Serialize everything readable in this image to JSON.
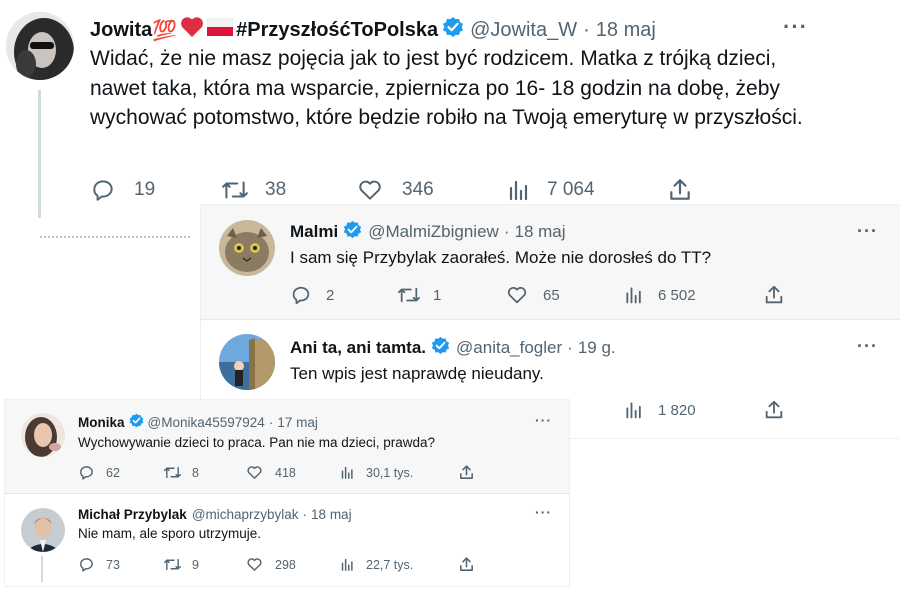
{
  "colors": {
    "verified": "#1d9bf0",
    "muted": "#536471",
    "text": "#0f1419",
    "heart": "#f91880",
    "flag_red": "#dc143c"
  },
  "tweets": [
    {
      "name": "Jowita",
      "emoji": "💯",
      "hashtag": "#PrzyszłośćToPolska",
      "verified": true,
      "handle": "@Jowita_W",
      "sep": "·",
      "date": "18 maj",
      "text": "Widać, że nie masz pojęcia jak to jest być rodzicem. Matka z trójką dzieci, nawet taka, która ma wsparcie, zpiernicza po 16- 18 godzin na dobę, żeby wychować potomstwo, które będzie robiło na Twoją emeryturę w przyszłości.",
      "replies": "19",
      "retweets": "38",
      "likes": "346",
      "views": "7 064",
      "icons": [
        "reply-icon",
        "retweet-icon",
        "like-icon",
        "views-icon",
        "share-icon"
      ]
    },
    {
      "name": "Malmi",
      "verified": true,
      "handle": "@MalmiZbigniew",
      "sep": "·",
      "date": "18 maj",
      "text": "I sam się Przybylak zaorałeś. Może nie dorosłeś do TT?",
      "replies": "2",
      "retweets": "1",
      "likes": "65",
      "views": "6 502"
    },
    {
      "name": "Ani ta, ani tamta.",
      "verified": true,
      "handle": "@anita_fogler",
      "sep": "·",
      "date": "19 g.",
      "text": "Ten wpis jest naprawdę nieudany.",
      "views": "1 820"
    },
    {
      "name": "Monika",
      "verified": true,
      "handle": "@Monika45597924",
      "sep": "·",
      "date": "17 maj",
      "text": "Wychowywanie dzieci to praca. Pan nie ma dzieci, prawda?",
      "replies": "62",
      "retweets": "8",
      "likes": "418",
      "views": "30,1 tys."
    },
    {
      "name": "Michał Przybylak",
      "verified": false,
      "handle": "@michaprzybylak",
      "sep": "·",
      "date": "18 maj",
      "text": "Nie mam, ale sporo utrzymuje.",
      "replies": "73",
      "retweets": "9",
      "likes": "298",
      "views": "22,7 tys."
    }
  ],
  "more_label": "···"
}
